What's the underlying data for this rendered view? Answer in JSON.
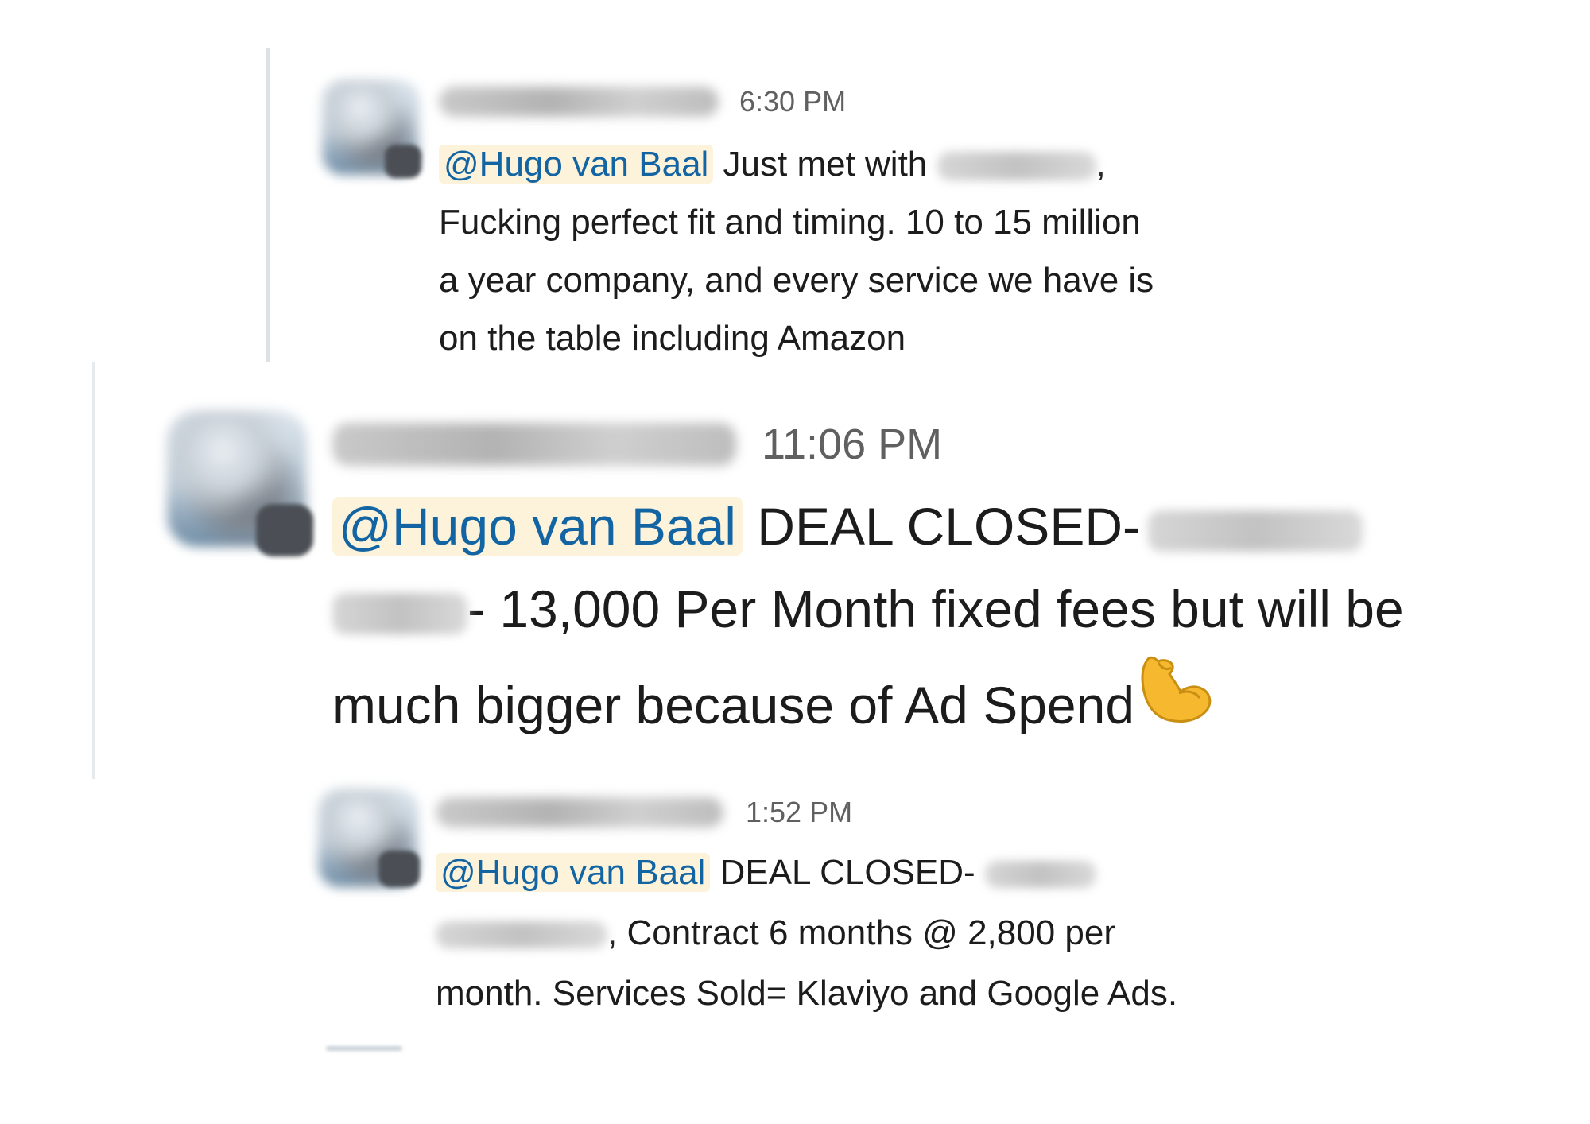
{
  "messages": [
    {
      "time": "6:30 PM",
      "mention": "@Hugo van Baal",
      "text_a": " Just met with ",
      "text_b": ",",
      "line2": "Fucking perfect fit and timing. 10 to 15 million",
      "line3": "a year company, and every service we have is",
      "line4": "on the table including Amazon"
    },
    {
      "time": "11:06 PM",
      "mention": "@Hugo van Baal",
      "text_a": " DEAL CLOSED-",
      "line2": "- 13,000 Per Month  fixed fees but will be",
      "line3": "much bigger because of Ad Spend",
      "emoji": "💪"
    },
    {
      "time": "1:52 PM",
      "mention": "@Hugo van Baal",
      "text_a": " DEAL CLOSED- ",
      "line2": ", Contract 6 months @ 2,800 per",
      "line3": "month. Services Sold= Klaviyo and Google Ads."
    }
  ],
  "colors": {
    "mention_bg": "#fdf3da",
    "mention_text": "#1264a3",
    "time_text": "#616061"
  }
}
